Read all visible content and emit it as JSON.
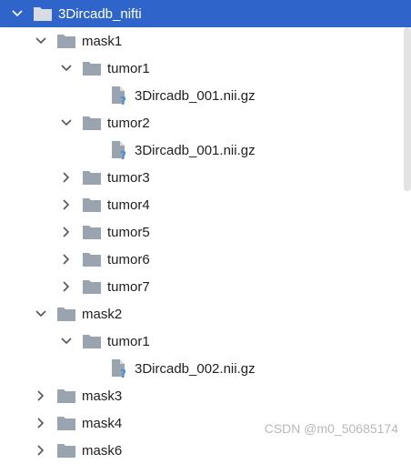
{
  "tree": {
    "root": {
      "label": "3Dircadb_nifti",
      "expanded": true,
      "selected": true,
      "icon": "folder-icon"
    },
    "nodes": [
      {
        "label": "mask1",
        "level": 1,
        "expanded": true,
        "icon": "folder-icon"
      },
      {
        "label": "tumor1",
        "level": 2,
        "expanded": true,
        "icon": "folder-icon"
      },
      {
        "label": "3Dircadb_001.nii.gz",
        "level": 3,
        "icon": "unknown-file-icon"
      },
      {
        "label": "tumor2",
        "level": 2,
        "expanded": true,
        "icon": "folder-icon"
      },
      {
        "label": "3Dircadb_001.nii.gz",
        "level": 3,
        "icon": "unknown-file-icon"
      },
      {
        "label": "tumor3",
        "level": 2,
        "expanded": false,
        "icon": "folder-icon"
      },
      {
        "label": "tumor4",
        "level": 2,
        "expanded": false,
        "icon": "folder-icon"
      },
      {
        "label": "tumor5",
        "level": 2,
        "expanded": false,
        "icon": "folder-icon"
      },
      {
        "label": "tumor6",
        "level": 2,
        "expanded": false,
        "icon": "folder-icon"
      },
      {
        "label": "tumor7",
        "level": 2,
        "expanded": false,
        "icon": "folder-icon"
      },
      {
        "label": "mask2",
        "level": 1,
        "expanded": true,
        "icon": "folder-icon"
      },
      {
        "label": "tumor1",
        "level": 2,
        "expanded": true,
        "icon": "folder-icon"
      },
      {
        "label": "3Dircadb_002.nii.gz",
        "level": 3,
        "icon": "unknown-file-icon"
      },
      {
        "label": "mask3",
        "level": 1,
        "expanded": false,
        "icon": "folder-icon"
      },
      {
        "label": "mask4",
        "level": 1,
        "expanded": false,
        "icon": "folder-icon"
      },
      {
        "label": "mask6",
        "level": 1,
        "expanded": false,
        "icon": "folder-icon"
      }
    ]
  },
  "colors": {
    "selection": "#2f65ca",
    "folder": "#9aa4b0",
    "file": "#9aa4b0",
    "question": "#3d8fd8"
  },
  "watermark": "CSDN @m0_50685174"
}
